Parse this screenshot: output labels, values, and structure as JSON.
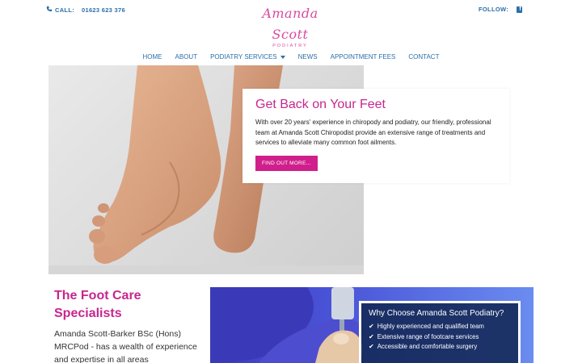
{
  "topbar": {
    "call_label": "CALL:",
    "phone": "01623 623 376",
    "follow_label": "FOLLOW:"
  },
  "logo": {
    "script_text": "Amanda Scott",
    "subtitle": "PODIATRY"
  },
  "nav": {
    "items": [
      {
        "label": "HOME"
      },
      {
        "label": "ABOUT"
      },
      {
        "label": "PODIATRY SERVICES"
      },
      {
        "label": "NEWS"
      },
      {
        "label": "APPOINTMENT FEES"
      },
      {
        "label": "CONTACT"
      }
    ]
  },
  "hero": {
    "title": "Get Back on Your Feet",
    "body": "With over 20 years' experience in chiropody and podiatry, our friendly, professional team at Amanda Scott Chiropodist provide an extensive range of treatments and services to alleviate many common foot ailments.",
    "cta": "FIND OUT MORE..."
  },
  "specialists": {
    "title": "The Foot Care Specialists",
    "body": "Amanda Scott-Barker BSc (Hons) MRCPod - has a wealth of experience and expertise in all areas"
  },
  "why": {
    "title": "Why Choose Amanda Scott Podiatry?",
    "items": [
      "Highly experienced and qualified team",
      "Extensive range of footcare services",
      "Accessible and comfortable surgery"
    ]
  },
  "colors": {
    "brand_pink": "#c7268f",
    "nav_blue": "#2a6fa8",
    "cta_pink": "#d01f8c",
    "card_navy": "#122855"
  },
  "icons": [
    "phone-icon",
    "facebook-icon",
    "chevron-down-icon",
    "check-icon"
  ]
}
